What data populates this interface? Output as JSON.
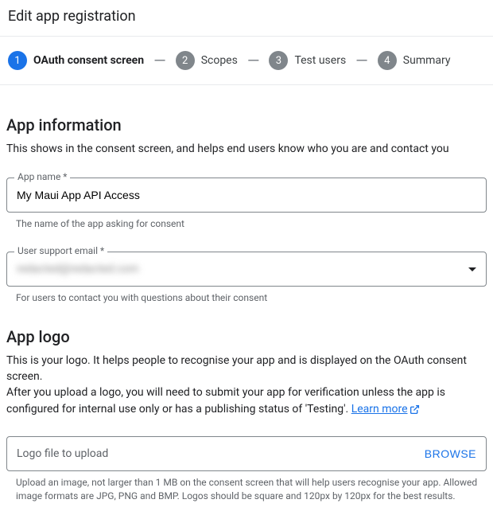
{
  "header": {
    "title": "Edit app registration"
  },
  "stepper": {
    "steps": [
      {
        "num": "1",
        "label": "OAuth consent screen",
        "active": true
      },
      {
        "num": "2",
        "label": "Scopes",
        "active": false
      },
      {
        "num": "3",
        "label": "Test users",
        "active": false
      },
      {
        "num": "4",
        "label": "Summary",
        "active": false
      }
    ]
  },
  "appInfo": {
    "title": "App information",
    "desc": "This shows in the consent screen, and helps end users know who you are and contact you",
    "appName": {
      "label": "App name *",
      "value": "My Maui App API Access",
      "helper": "The name of the app asking for consent"
    },
    "supportEmail": {
      "label": "User support email *",
      "value": "redacted@redacted.com",
      "helper": "For users to contact you with questions about their consent"
    }
  },
  "appLogo": {
    "title": "App logo",
    "desc1": "This is your logo. It helps people to recognise your app and is displayed on the OAuth consent screen.",
    "desc2a": "After you upload a logo, you will need to submit your app for verification unless the app is configured for internal use only or has a publishing status of 'Testing'. ",
    "learnMore": "Learn more",
    "upload": {
      "placeholder": "Logo file to upload",
      "button": "BROWSE",
      "helper": "Upload an image, not larger than 1 MB on the consent screen that will help users recognise your app. Allowed image formats are JPG, PNG and BMP. Logos should be square and 120px by 120px for the best results."
    }
  }
}
